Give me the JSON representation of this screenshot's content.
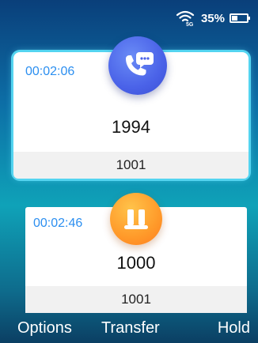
{
  "status_bar": {
    "network_label": "5G",
    "battery_percent": "35%",
    "battery_level": 0.35
  },
  "calls": {
    "active": {
      "timer": "00:02:06",
      "number": "1994",
      "line": "1001",
      "icon": "active-call-icon",
      "accent_color": "#4a62e8"
    },
    "held": {
      "timer": "00:02:46",
      "number": "1000",
      "line": "1001",
      "icon": "hold-pause-icon",
      "accent_color": "#ff9a2a"
    }
  },
  "softkeys": {
    "left": "Options",
    "center": "Transfer",
    "right": "Hold"
  },
  "colors": {
    "timer": "#2c8ff0",
    "active_glow": "#54d4f0"
  }
}
